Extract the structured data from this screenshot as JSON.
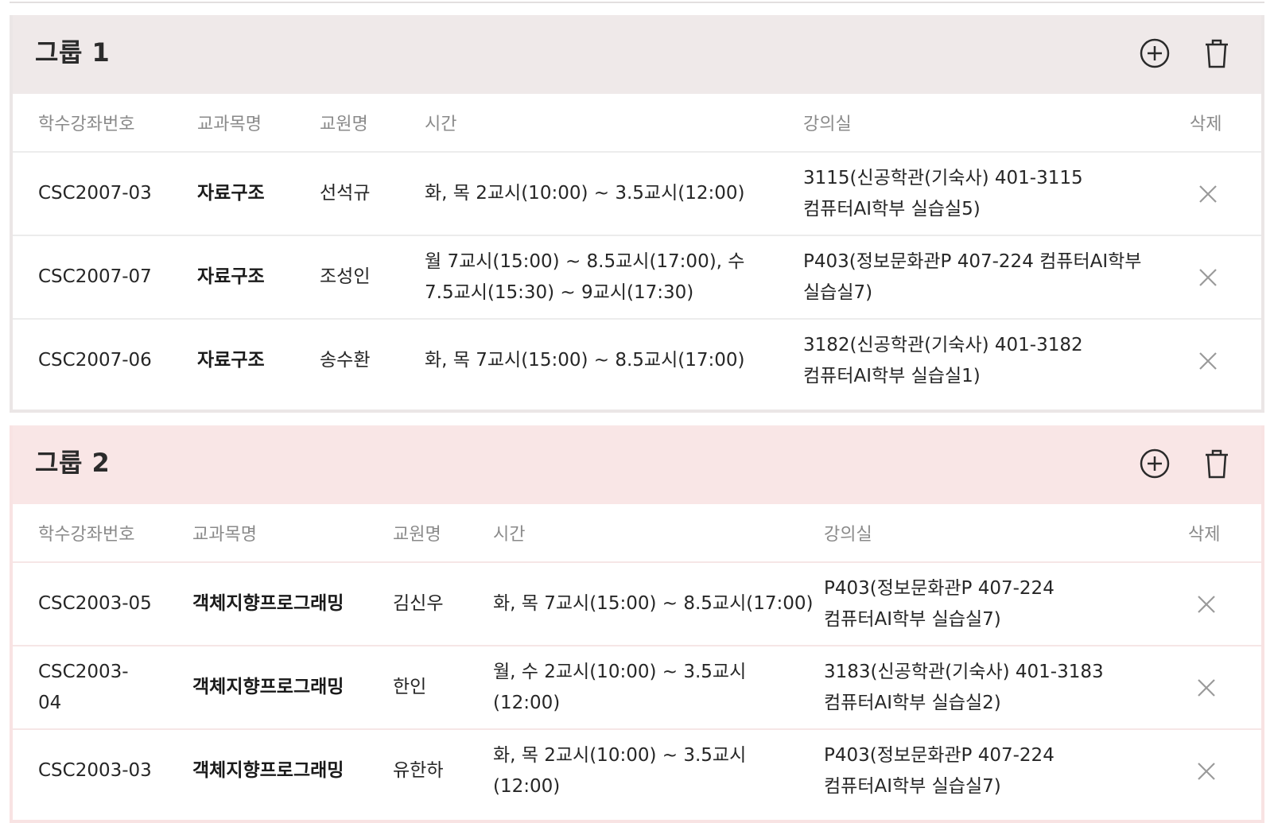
{
  "columns": {
    "code": "학수강좌번호",
    "course": "교과목명",
    "professor": "교원명",
    "time": "시간",
    "room": "강의실",
    "delete": "삭제"
  },
  "icons": {
    "add": "plus-circle-icon",
    "trash": "trash-icon",
    "remove": "close-icon"
  },
  "colors": {
    "group1_header": "#efe9e9",
    "group2_header": "#f9e6e6"
  },
  "groups": [
    {
      "title": "그룹 1",
      "rows": [
        {
          "code": "CSC2007-03",
          "course": "자료구조",
          "professor": "선석규",
          "time": "화, 목 2교시(10:00) ~ 3.5교시(12:00)",
          "room": "3115(신공학관(기숙사) 401-3115 컴퓨터AI학부 실습실5)"
        },
        {
          "code": "CSC2007-07",
          "course": "자료구조",
          "professor": "조성인",
          "time": "월 7교시(15:00) ~ 8.5교시(17:00), 수 7.5교시(15:30) ~ 9교시(17:30)",
          "room": "P403(정보문화관P 407-224 컴퓨터AI학부 실습실7)"
        },
        {
          "code": "CSC2007-06",
          "course": "자료구조",
          "professor": "송수환",
          "time": "화, 목 7교시(15:00) ~ 8.5교시(17:00)",
          "room": "3182(신공학관(기숙사) 401-3182 컴퓨터AI학부 실습실1)"
        }
      ]
    },
    {
      "title": "그룹 2",
      "rows": [
        {
          "code": "CSC2003-05",
          "course": "객체지향프로그래밍",
          "professor": "김신우",
          "time": "화, 목 7교시(15:00) ~ 8.5교시(17:00)",
          "room": "P403(정보문화관P 407-224 컴퓨터AI학부 실습실7)"
        },
        {
          "code": "CSC2003-04",
          "course": "객체지향프로그래밍",
          "professor": "한인",
          "time": "월, 수 2교시(10:00) ~ 3.5교시(12:00)",
          "room": "3183(신공학관(기숙사) 401-3183 컴퓨터AI학부 실습실2)"
        },
        {
          "code": "CSC2003-03",
          "course": "객체지향프로그래밍",
          "professor": "유한하",
          "time": "화, 목 2교시(10:00) ~ 3.5교시(12:00)",
          "room": "P403(정보문화관P 407-224 컴퓨터AI학부 실습실7)"
        }
      ]
    }
  ]
}
